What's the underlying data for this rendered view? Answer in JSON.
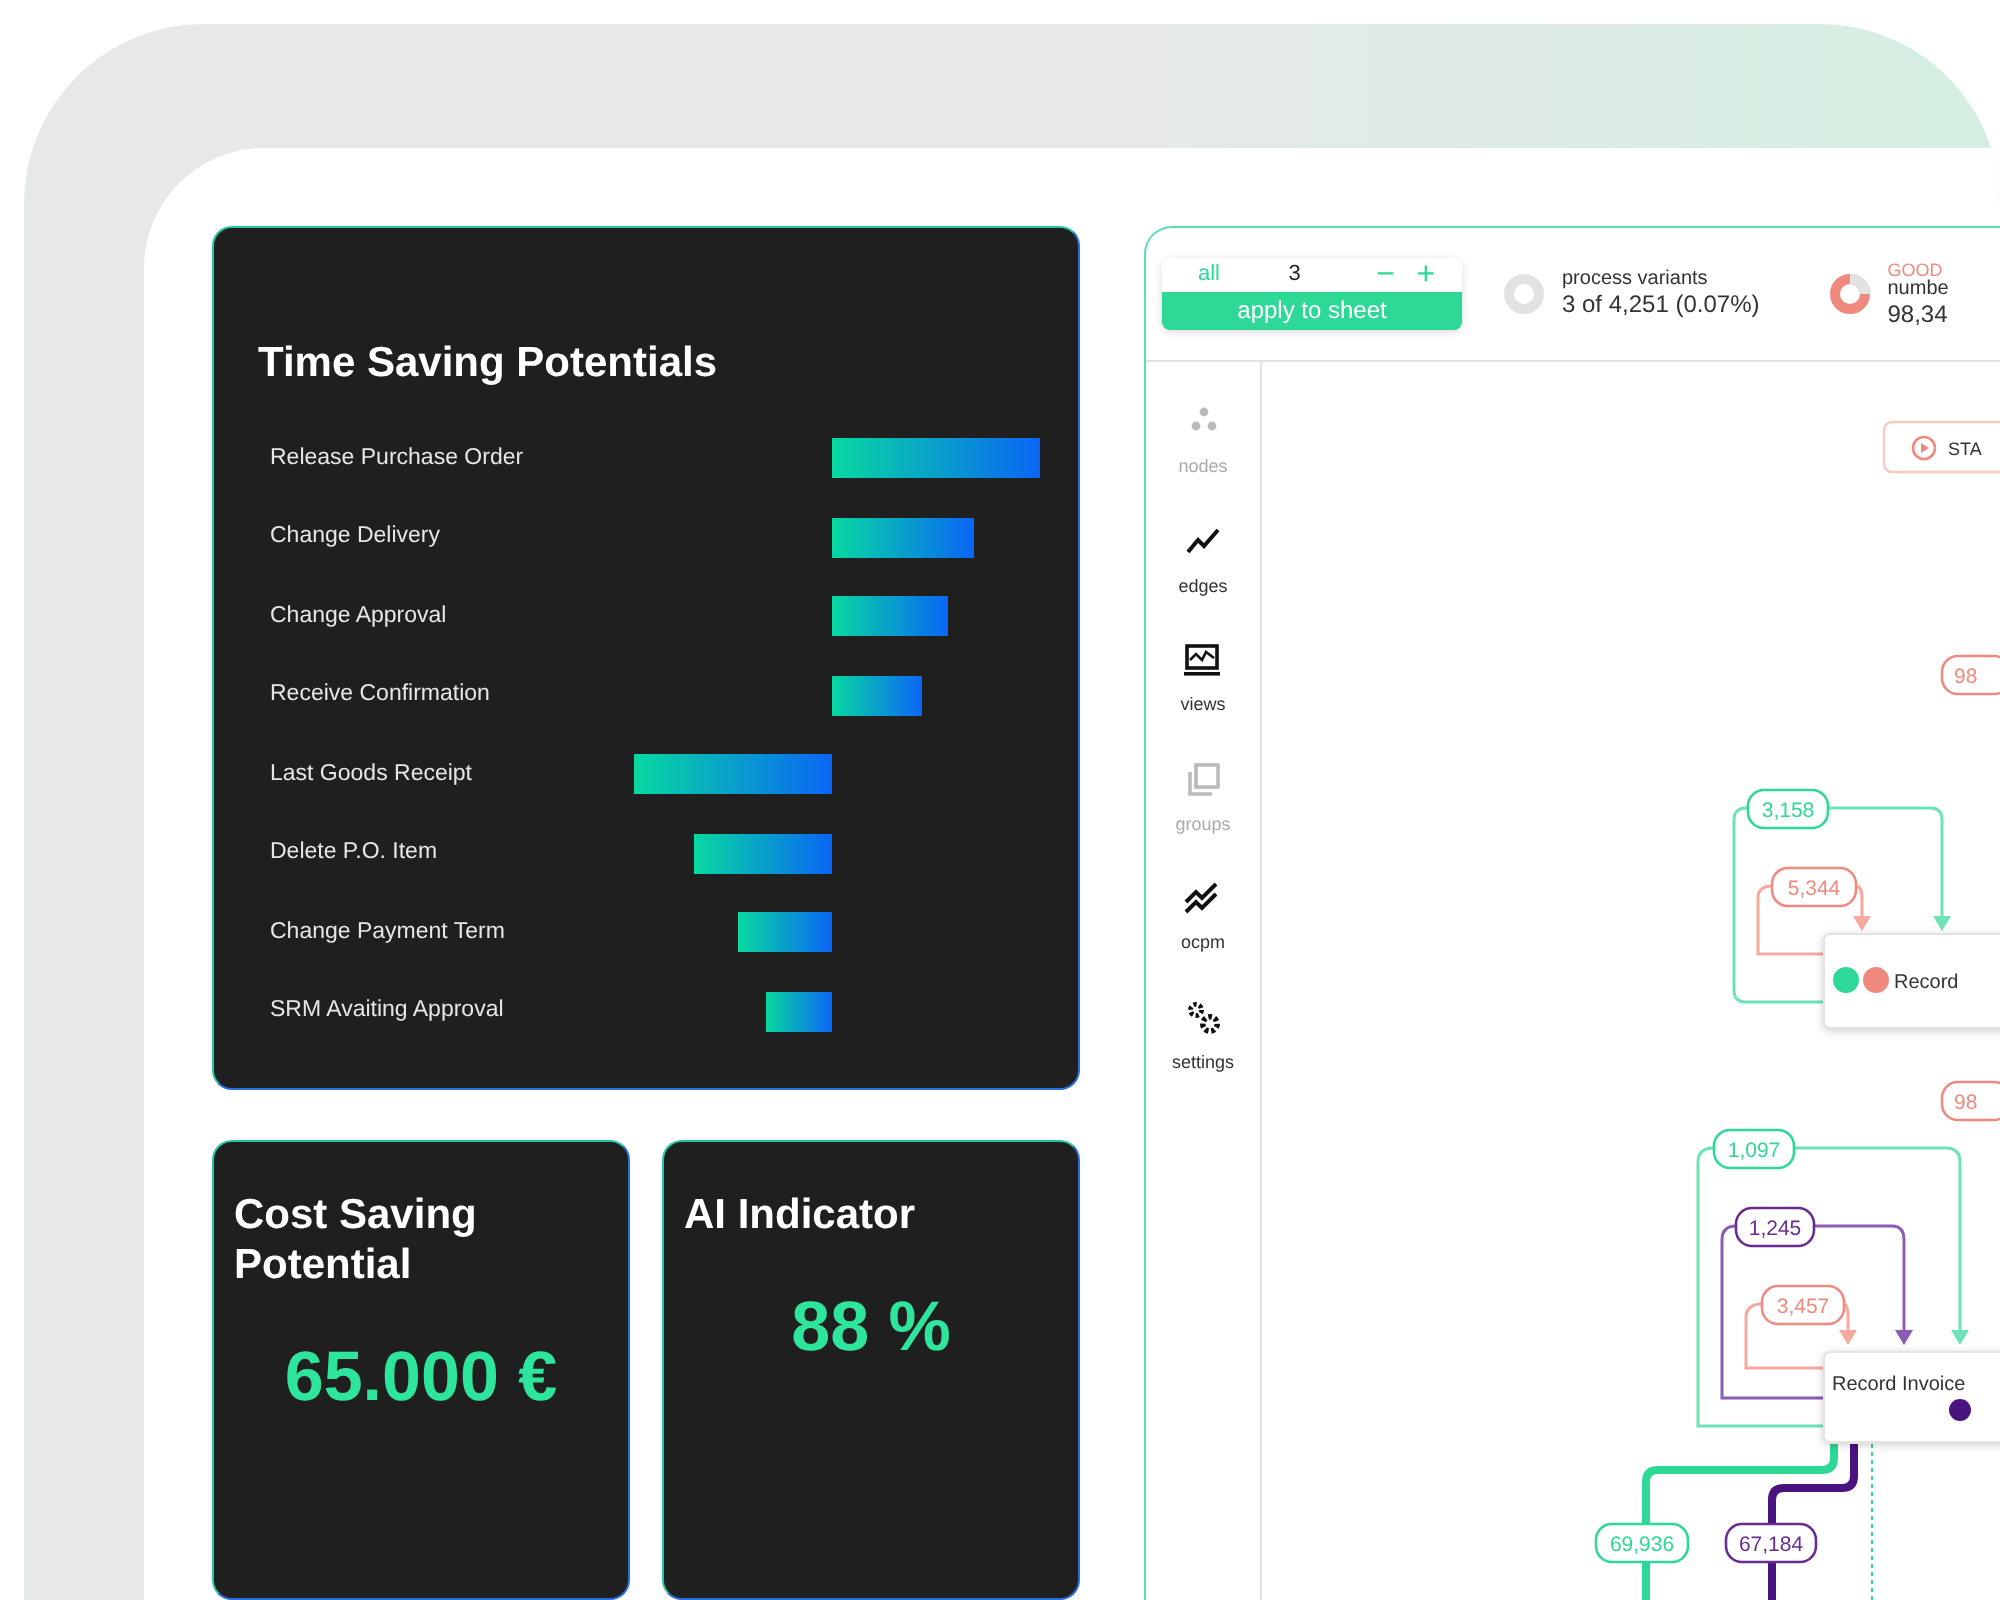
{
  "time_saving": {
    "title": "Time Saving Potentials",
    "rows": [
      {
        "label": "Release Purchase Order"
      },
      {
        "label": "Change Delivery"
      },
      {
        "label": "Change Approval"
      },
      {
        "label": "Receive Confirmation"
      },
      {
        "label": "Last Goods Receipt"
      },
      {
        "label": "Delete P.O. Item"
      },
      {
        "label": "Change Payment Term"
      },
      {
        "label": "SRM Avaiting Approval"
      }
    ]
  },
  "cost_saving": {
    "title": "Cost Saving Potential",
    "value": "65.000 €"
  },
  "ai_indicator": {
    "title": "AI Indicator",
    "value": "88 %"
  },
  "process_explorer": {
    "toolbar": {
      "filter": {
        "all_label": "all",
        "count": "3",
        "minus": "−",
        "plus": "+",
        "apply": "apply to sheet"
      },
      "variants": {
        "label": "process variants",
        "value": "3 of 4,251 (0.07%)"
      },
      "goods": {
        "label": "GOOD",
        "sublabel": "numbe",
        "value": "98,34"
      }
    },
    "sidebar": [
      {
        "label": "nodes",
        "kind": "nodes",
        "disabled": true
      },
      {
        "label": "edges",
        "kind": "edges",
        "disabled": false
      },
      {
        "label": "views",
        "kind": "views",
        "disabled": false
      },
      {
        "label": "groups",
        "kind": "groups",
        "disabled": true
      },
      {
        "label": "ocpm",
        "kind": "ocpm",
        "disabled": false
      },
      {
        "label": "settings",
        "kind": "settings",
        "disabled": false
      }
    ],
    "map": {
      "start": "STA",
      "nodes": [
        {
          "label": "Record"
        },
        {
          "label": "Record Invoice"
        }
      ],
      "edge_labels": [
        {
          "text": "98",
          "color": "#f08a7e"
        },
        {
          "text": "3,158",
          "color": "#2ed896"
        },
        {
          "text": "5,344",
          "color": "#f08a7e"
        },
        {
          "text": "98",
          "color": "#f08a7e"
        },
        {
          "text": "1,097",
          "color": "#2ed896"
        },
        {
          "text": "1,245",
          "color": "#6a2c91"
        },
        {
          "text": "3,457",
          "color": "#f08a7e"
        },
        {
          "text": "69,936",
          "color": "#2ed896"
        },
        {
          "text": "67,184",
          "color": "#6a2c91"
        }
      ]
    }
  }
}
